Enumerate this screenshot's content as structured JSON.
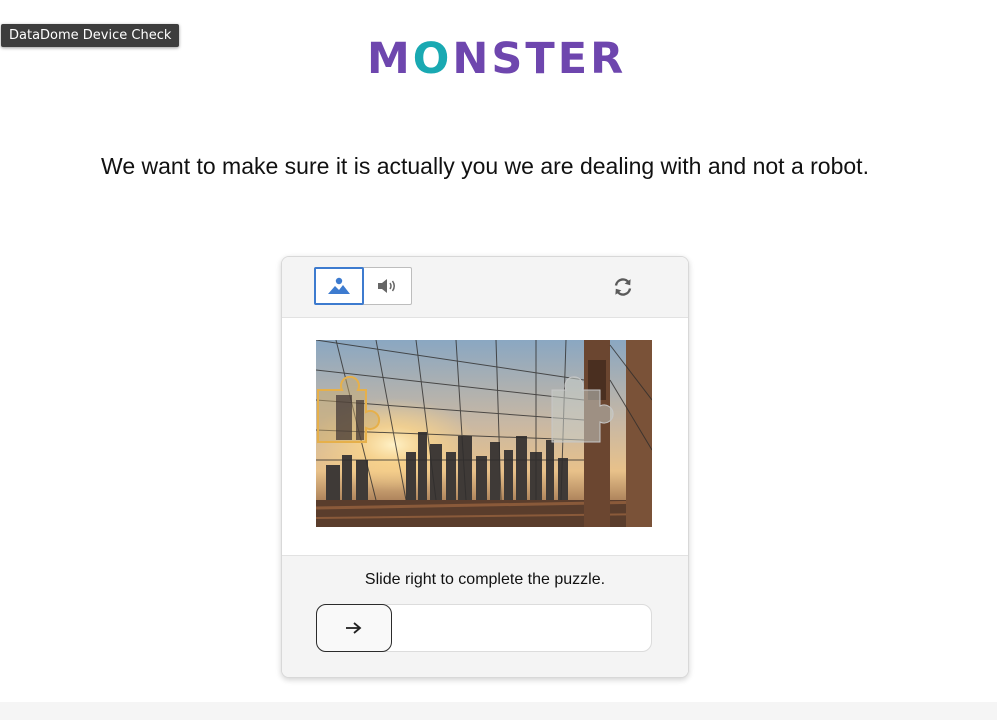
{
  "tooltip": "DataDome Device Check",
  "logo": {
    "letters": [
      "M",
      "O",
      "N",
      "S",
      "T",
      "E",
      "R"
    ],
    "colors": [
      "#6e46ae",
      "#19a9b2",
      "#6e46ae",
      "#6e46ae",
      "#6e46ae",
      "#6e46ae",
      "#6e46ae"
    ]
  },
  "headline": "We want to make sure it is actually you we are dealing with and not a robot.",
  "captcha": {
    "modes": [
      {
        "name": "image-mode",
        "icon": "mountain-icon",
        "active": true
      },
      {
        "name": "audio-mode",
        "icon": "speaker-icon",
        "active": false
      }
    ],
    "refresh_icon": "refresh-icon",
    "instruction": "Slide right to complete the puzzle.",
    "slider_icon": "arrow-right-icon",
    "accent_color": "#3d7bcf"
  }
}
